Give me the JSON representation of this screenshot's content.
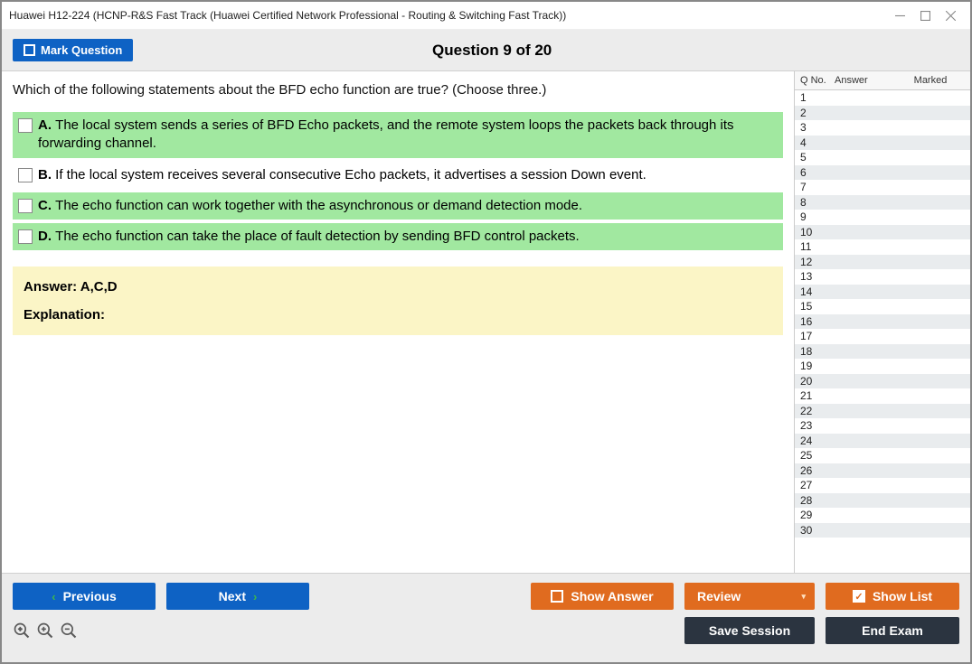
{
  "window": {
    "title": "Huawei H12-224 (HCNP-R&S Fast Track (Huawei Certified Network Professional - Routing & Switching Fast Track))"
  },
  "header": {
    "mark_label": "Mark Question",
    "title": "Question 9 of 20"
  },
  "question": {
    "text": "Which of the following statements about the BFD echo function are true? (Choose three.)",
    "options": [
      {
        "letter": "A.",
        "text": "The local system sends a series of BFD Echo packets, and the remote system loops the packets back through its forwarding channel.",
        "correct": true
      },
      {
        "letter": "B.",
        "text": "If the local system receives several consecutive Echo packets, it advertises a session Down event.",
        "correct": false
      },
      {
        "letter": "C.",
        "text": "The echo function can work together with the asynchronous or demand detection mode.",
        "correct": true
      },
      {
        "letter": "D.",
        "text": "The echo function can take the place of fault detection by sending BFD control packets.",
        "correct": true
      }
    ],
    "answer_label": "Answer: A,C,D",
    "explanation_label": "Explanation:"
  },
  "side": {
    "h_qno": "Q No.",
    "h_answer": "Answer",
    "h_marked": "Marked",
    "rows": [
      {
        "n": "1"
      },
      {
        "n": "2"
      },
      {
        "n": "3"
      },
      {
        "n": "4"
      },
      {
        "n": "5"
      },
      {
        "n": "6"
      },
      {
        "n": "7"
      },
      {
        "n": "8"
      },
      {
        "n": "9"
      },
      {
        "n": "10"
      },
      {
        "n": "11"
      },
      {
        "n": "12"
      },
      {
        "n": "13"
      },
      {
        "n": "14"
      },
      {
        "n": "15"
      },
      {
        "n": "16"
      },
      {
        "n": "17"
      },
      {
        "n": "18"
      },
      {
        "n": "19"
      },
      {
        "n": "20"
      },
      {
        "n": "21"
      },
      {
        "n": "22"
      },
      {
        "n": "23"
      },
      {
        "n": "24"
      },
      {
        "n": "25"
      },
      {
        "n": "26"
      },
      {
        "n": "27"
      },
      {
        "n": "28"
      },
      {
        "n": "29"
      },
      {
        "n": "30"
      }
    ]
  },
  "footer": {
    "previous": "Previous",
    "next": "Next",
    "show_answer": "Show Answer",
    "review": "Review",
    "show_list": "Show List",
    "save_session": "Save Session",
    "end_exam": "End Exam"
  }
}
